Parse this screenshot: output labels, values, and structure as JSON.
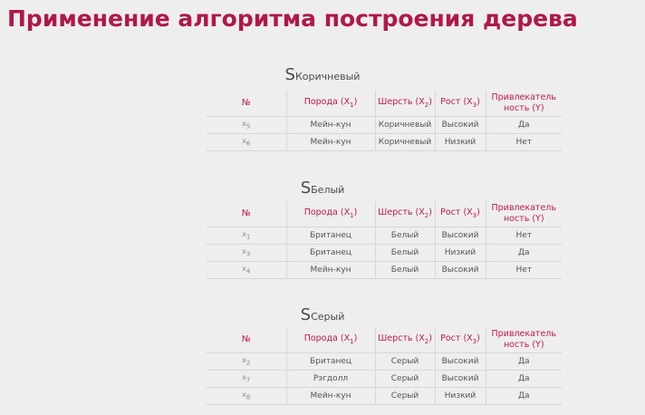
{
  "title": "Применение алгоритма построения дерева",
  "headers": {
    "num": "№",
    "breed": "Порода (X",
    "breed_sub": "1",
    "fur": "Шерсть (X",
    "fur_sub": "2",
    "height": "Рост (X",
    "height_sub": "3",
    "attract_line1": "Привлекатель",
    "attract_line2": "ность (Y)",
    "close_paren": ")"
  },
  "subsets": [
    {
      "title_main": "S",
      "title_sub": "Коричневый",
      "rows": [
        {
          "id": "x",
          "id_sub": "5",
          "breed": "Мейн-кун",
          "fur": "Коричневый",
          "height": "Высокий",
          "y": "Да"
        },
        {
          "id": "x",
          "id_sub": "6",
          "breed": "Мейн-кун",
          "fur": "Коричневый",
          "height": "Низкий",
          "y": "Нет"
        }
      ]
    },
    {
      "title_main": "S",
      "title_sub": "Белый",
      "rows": [
        {
          "id": "x",
          "id_sub": "1",
          "breed": "Британец",
          "fur": "Белый",
          "height": "Высокий",
          "y": "Нет"
        },
        {
          "id": "x",
          "id_sub": "3",
          "breed": "Британец",
          "fur": "Белый",
          "height": "Низкий",
          "y": "Да"
        },
        {
          "id": "x",
          "id_sub": "4",
          "breed": "Мейн-кун",
          "fur": "Белый",
          "height": "Высокий",
          "y": "Нет"
        }
      ]
    },
    {
      "title_main": "S",
      "title_sub": "Серый",
      "rows": [
        {
          "id": "x",
          "id_sub": "2",
          "breed": "Британец",
          "fur": "Серый",
          "height": "Высокий",
          "y": "Да"
        },
        {
          "id": "x",
          "id_sub": "7",
          "breed": "Рэгдолл",
          "fur": "Серый",
          "height": "Высокий",
          "y": "Да"
        },
        {
          "id": "x",
          "id_sub": "8",
          "breed": "Мейн-кун",
          "fur": "Серый",
          "height": "Низкий",
          "y": "Да"
        }
      ]
    }
  ]
}
